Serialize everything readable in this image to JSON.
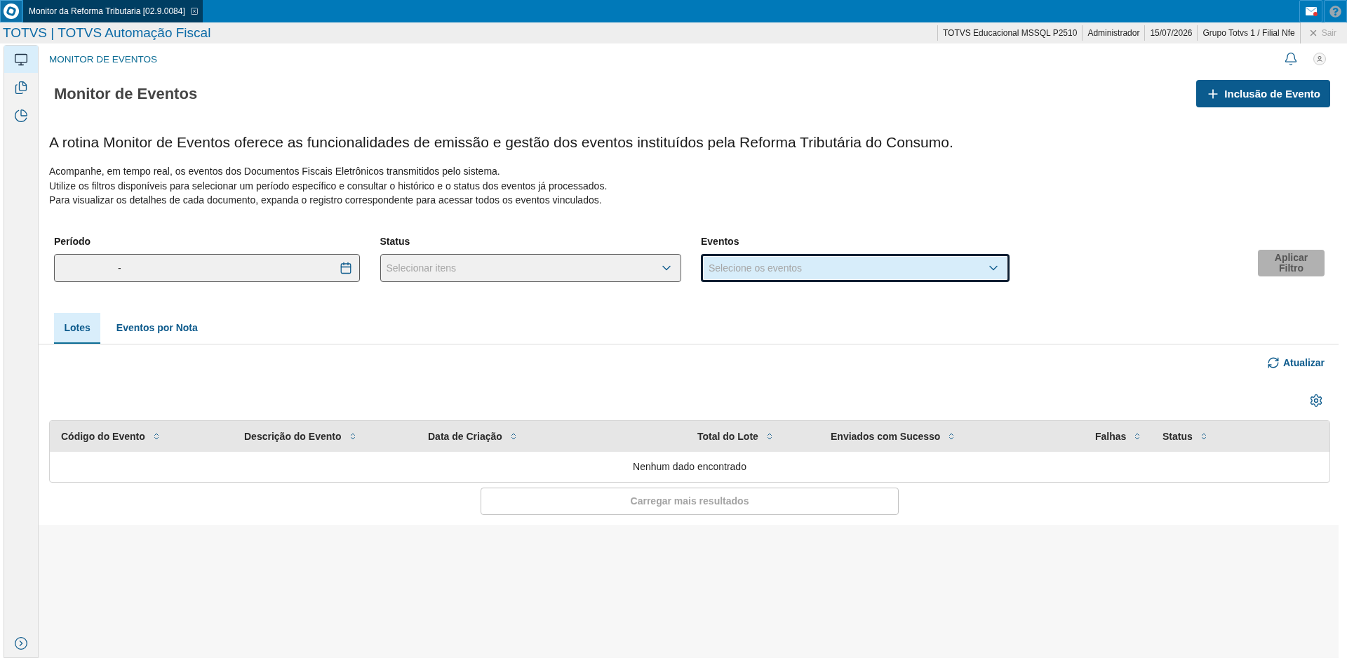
{
  "top_bar": {
    "tab_title": "Monitor da Reforma Tributaria [02.9.0084]",
    "messages_unread": true
  },
  "header": {
    "product": "TOTVS | TOTVS Automação Fiscal",
    "info": [
      "TOTVS Educacional MSSQL P2510",
      "Administrador",
      "15/07/2026",
      "Grupo Totvs 1 / Filial Nfe"
    ],
    "logout": {
      "label": "Sair",
      "disabled": true
    }
  },
  "sidebar": {
    "items": [
      {
        "kind": "monitor",
        "selected": true
      },
      {
        "kind": "documents",
        "selected": false
      },
      {
        "kind": "chart",
        "selected": false
      }
    ]
  },
  "breadcrumb": "MONITOR DE EVENTOS",
  "page": {
    "title": "Monitor de Eventos",
    "add_button": "Inclusão de Evento",
    "headline": "A rotina Monitor de Eventos oferece as funcionalidades de emissão e gestão dos eventos instituídos pela Reforma Tributária do Consumo.",
    "description": [
      "Acompanhe, em tempo real, os eventos dos Documentos Fiscais Eletrônicos transmitidos pelo sistema.",
      "Utilize os filtros disponíveis para selecionar um período específico e consultar o histórico e o status dos eventos já processados.",
      "Para visualizar os detalhes de cada documento, expanda o registro correspondente para acessar todos os eventos vinculados."
    ]
  },
  "filters": {
    "fields": [
      {
        "kind": "date_range",
        "label": "Período",
        "separator": "-",
        "focused": false
      },
      {
        "kind": "select",
        "label": "Status",
        "placeholder": "Selecionar itens",
        "focused": false
      },
      {
        "kind": "select",
        "label": "Eventos",
        "placeholder": "Selecione os eventos",
        "focused": true
      }
    ],
    "apply_button": {
      "label": "Aplicar Filtro",
      "disabled": true
    }
  },
  "tabs": [
    {
      "label": "Lotes",
      "selected": true
    },
    {
      "label": "Eventos por Nota",
      "selected": false
    }
  ],
  "refresh_button": "Atualizar",
  "table": {
    "columns": [
      "Código do Evento",
      "Descrição do Evento",
      "Data de Criação",
      "Total do Lote",
      "Enviados com Sucesso",
      "Falhas",
      "Status"
    ],
    "empty_message": "Nenhum dado encontrado"
  },
  "load_more": {
    "label": "Carregar mais resultados",
    "disabled": true
  }
}
